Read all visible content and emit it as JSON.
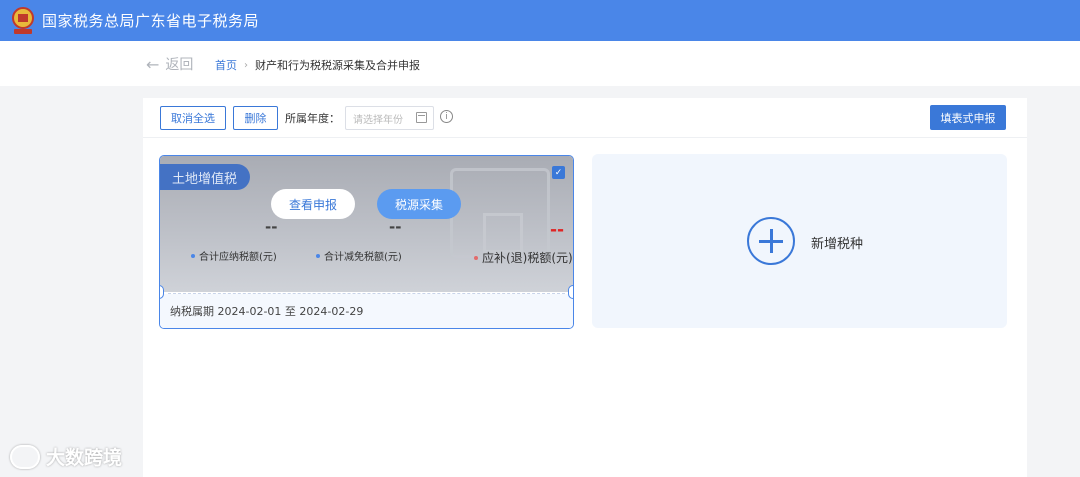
{
  "header": {
    "title": "国家税务总局广东省电子税务局",
    "emblem_icon": "tax-emblem-icon"
  },
  "nav": {
    "back_label": "返回",
    "breadcrumb": {
      "home": "首页",
      "current": "财产和行为税税源采集及合并申报"
    }
  },
  "toolbar": {
    "deselect_all": "取消全选",
    "delete": "删除",
    "year_label": "所属年度：",
    "year_placeholder": "请选择年份",
    "fill_declare": "填表式申报"
  },
  "tax_card": {
    "name": "土地增值税",
    "selected": true,
    "view_button": "查看申报",
    "collect_button": "税源采集",
    "metrics": [
      {
        "value": "--",
        "label": "合计应纳税额(元)"
      },
      {
        "value": "--",
        "label": "合计减免税额(元)"
      },
      {
        "value": "--",
        "label": "应补(退)税额(元)"
      }
    ],
    "period": "纳税属期 2024-02-01 至 2024-02-29"
  },
  "add_card": {
    "label": "新增税种"
  },
  "watermark": {
    "text": "大数跨境"
  },
  "colors": {
    "topbar": "#4a86e8",
    "primary": "#3a78d8",
    "red": "#e02424"
  }
}
